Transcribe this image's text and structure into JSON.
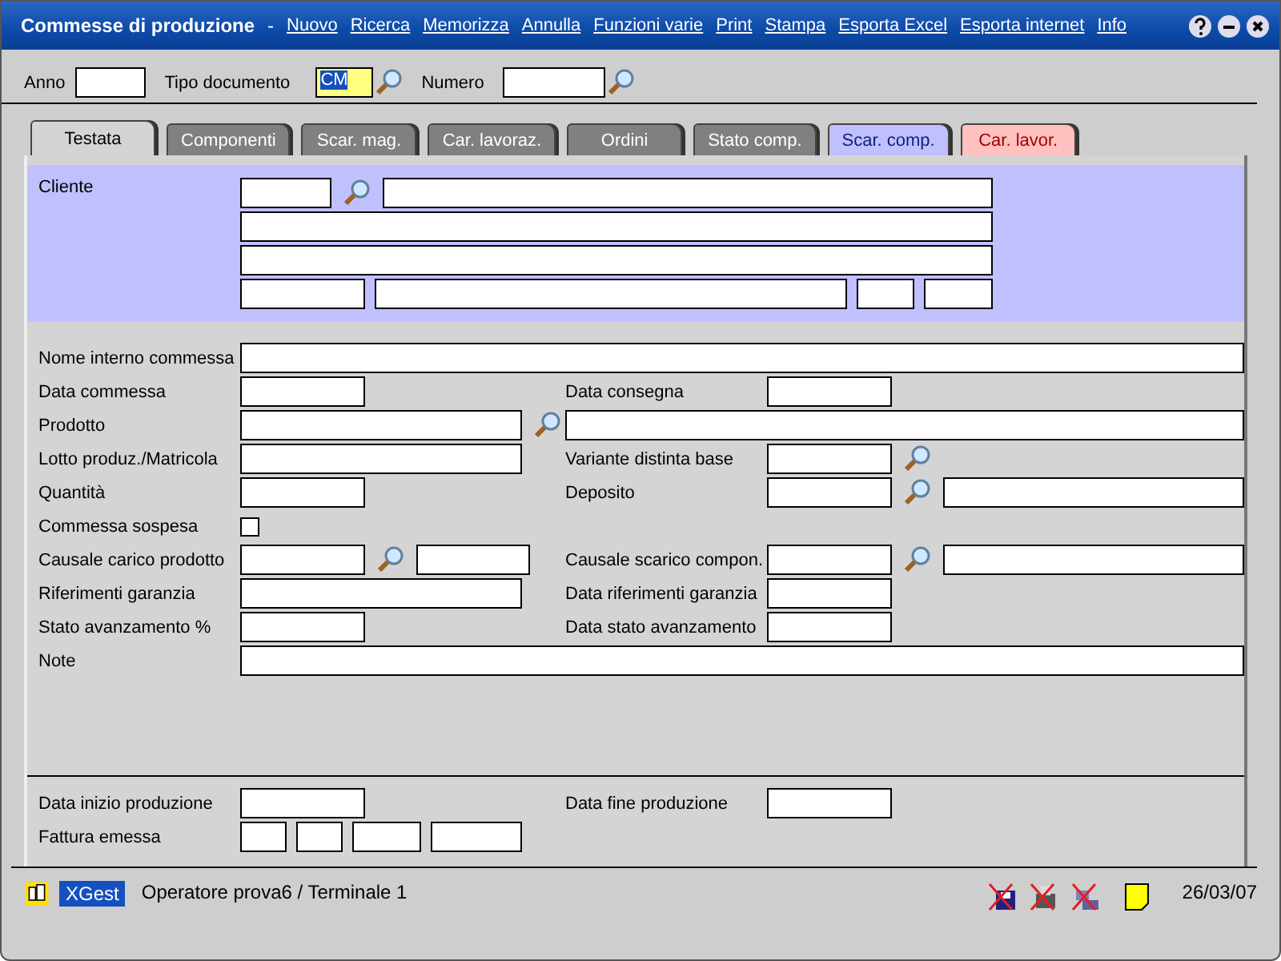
{
  "window": {
    "title": "Commesse di produzione",
    "separator": "-"
  },
  "menu": [
    "Nuovo",
    "Ricerca",
    "Memorizza",
    "Annulla",
    "Funzioni varie",
    "Print",
    "Stampa",
    "Esporta Excel",
    "Esporta internet",
    "Info"
  ],
  "header": {
    "anno_label": "Anno",
    "tipo_label": "Tipo documento",
    "tipo_value": "CM",
    "numero_label": "Numero"
  },
  "tabs": [
    {
      "label": "Testata",
      "selected": true,
      "color": "#d4d4d4"
    },
    {
      "label": "Componenti",
      "selected": false,
      "color": "#808080"
    },
    {
      "label": "Scar. mag.",
      "selected": false,
      "color": "#808080"
    },
    {
      "label": "Car. lavoraz.",
      "selected": false,
      "color": "#808080"
    },
    {
      "label": "Ordini",
      "selected": false,
      "color": "#808080"
    },
    {
      "label": "Stato comp.",
      "selected": false,
      "color": "#808080"
    },
    {
      "label": "Scar. comp.",
      "selected": false,
      "color": "#c0c0ff"
    },
    {
      "label": "Car. lavor.",
      "selected": false,
      "color": "#ffc0c0"
    }
  ],
  "cliente": {
    "label": "Cliente"
  },
  "rows": [
    {
      "label": "Nome interno commessa",
      "left": [
        {
          "kind": "wide"
        }
      ]
    },
    {
      "label": "Data commessa",
      "left": [
        {
          "kind": "date"
        }
      ],
      "right_label": "Data consegna",
      "right": [
        {
          "kind": "date"
        }
      ]
    },
    {
      "label": "Prodotto",
      "left": [
        {
          "kind": "code"
        },
        {
          "kind": "lens"
        }
      ],
      "right": [
        {
          "kind": "wide"
        }
      ]
    },
    {
      "label": "Lotto produz./Matricola",
      "left": [
        {
          "kind": "code"
        }
      ],
      "right_label": "Variante distinta base",
      "right": [
        {
          "kind": "date"
        },
        {
          "kind": "lens"
        }
      ]
    },
    {
      "label": "Quantità",
      "left": [
        {
          "kind": "date"
        }
      ],
      "right_label": "Deposito",
      "right": [
        {
          "kind": "date"
        },
        {
          "kind": "lens"
        },
        {
          "kind": "wide"
        }
      ]
    },
    {
      "label": "Commessa sospesa",
      "left": [
        {
          "kind": "check",
          "checked": false
        }
      ]
    },
    {
      "label": "Causale carico prodotto",
      "left": [
        {
          "kind": "date"
        },
        {
          "kind": "lens"
        },
        {
          "kind": "mid"
        }
      ],
      "right_label": "Causale scarico compon.",
      "right": [
        {
          "kind": "date"
        },
        {
          "kind": "lens"
        },
        {
          "kind": "wide"
        }
      ]
    },
    {
      "label": "Riferimenti garanzia",
      "left": [
        {
          "kind": "code"
        }
      ],
      "right_label": "Data riferimenti garanzia",
      "right": [
        {
          "kind": "date"
        }
      ]
    },
    {
      "label": "Stato avanzamento %",
      "left": [
        {
          "kind": "date"
        }
      ],
      "right_label": "Data stato avanzamento",
      "right": [
        {
          "kind": "date"
        }
      ]
    },
    {
      "label": "Note",
      "left": [
        {
          "kind": "wide"
        }
      ]
    }
  ],
  "footer_rows": [
    {
      "label": "Data inizio produzione",
      "left": [
        {
          "kind": "date"
        }
      ],
      "right_label": "Data fine produzione",
      "right": [
        {
          "kind": "date"
        }
      ]
    },
    {
      "label": "Fattura emessa",
      "left": [
        {
          "kind": "tiny"
        },
        {
          "kind": "tiny"
        },
        {
          "kind": "small"
        },
        {
          "kind": "mid2"
        }
      ]
    }
  ],
  "status": {
    "app": "XGest",
    "operator": "Operatore prova6 / Terminale 1",
    "date": "26/03/07"
  }
}
